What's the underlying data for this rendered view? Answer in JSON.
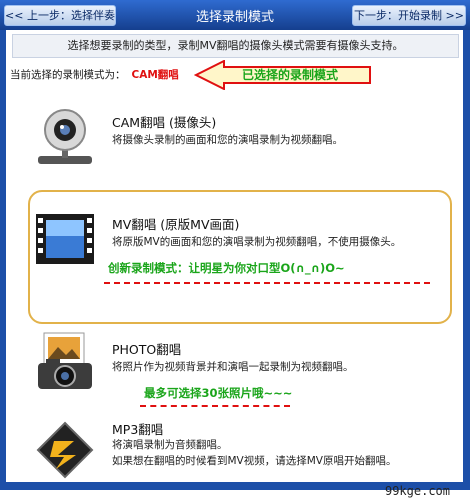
{
  "header": {
    "prev_label": "<< 上一步：选择伴奏",
    "title": "选择录制模式",
    "next_label": "下一步：开始录制 >>"
  },
  "hint": "选择想要录制的类型，录制MV翻唱的摄像头模式需要有摄像头支持。",
  "current": {
    "label": "当前选择的录制模式为：",
    "value": "CAM翻唱"
  },
  "annotation": "已选择的录制模式",
  "options": [
    {
      "title": "CAM翻唱 (摄像头)",
      "desc": [
        "将摄像头录制的画面和您的演唱录制为视频翻唱。"
      ],
      "icon": "webcam-icon"
    },
    {
      "title": "MV翻唱 (原版MV画面)",
      "desc": [
        "将原版MV的画面和您的演唱录制为视频翻唱，不使用摄像头。"
      ],
      "note": "创新录制模式：让明星为你对口型O(∩_∩)O~",
      "icon": "film-icon"
    },
    {
      "title": "PHOTO翻唱",
      "desc": [
        "将照片作为视频背景并和演唱一起录制为视频翻唱。"
      ],
      "note": "最多可选择30张照片哦~~~",
      "icon": "photo-camera-icon"
    },
    {
      "title": "MP3翻唱",
      "desc": [
        "将演唱录制为音频翻唱。",
        "如果想在翻唱的时候看到MV视频，请选择MV原唱开始翻唱。"
      ],
      "icon": "winamp-bolt-icon"
    }
  ],
  "watermark": "99kge.com",
  "colors": {
    "header": "#1d4fa8",
    "highlight_border": "#e2b24a",
    "annotation_green": "#1aa51a",
    "accent_red": "#e01010"
  }
}
